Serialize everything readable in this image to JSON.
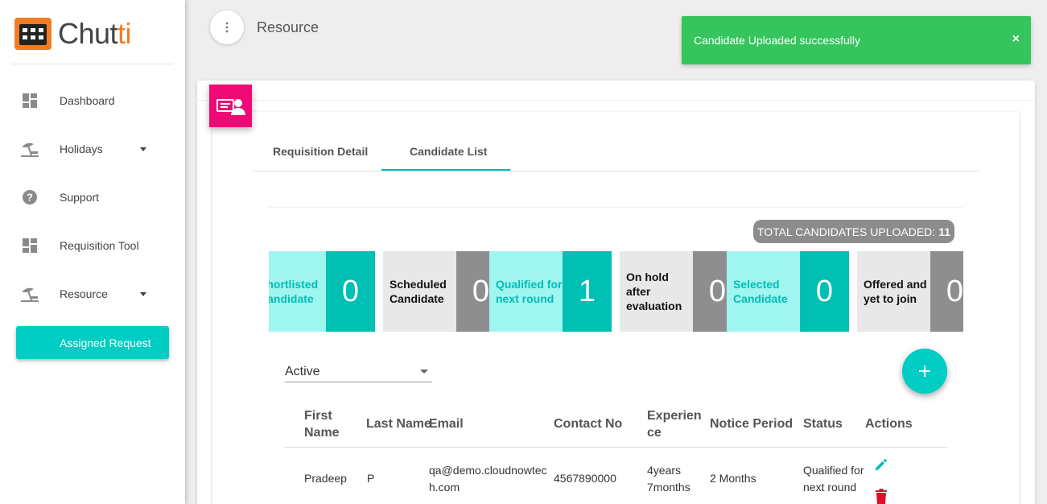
{
  "brand": {
    "name_main": "Chut",
    "name_accent": "ti"
  },
  "sidebar": {
    "items": [
      {
        "label": "Dashboard",
        "icon": "dashboard-icon"
      },
      {
        "label": "Holidays",
        "icon": "beach-icon"
      },
      {
        "label": "Support",
        "icon": "help-icon"
      },
      {
        "label": "Requisition Tool",
        "icon": "dashboard-icon"
      },
      {
        "label": "Resource",
        "icon": "beach-icon"
      }
    ],
    "button": "Assigned Request"
  },
  "header": {
    "title": "Resource"
  },
  "toast": {
    "message": "Candidate Uploaded successfully",
    "close": "×"
  },
  "tabs": [
    "Requisition Detail",
    "Candidate List"
  ],
  "active_tab": "Candidate List",
  "total": {
    "label": "TOTAL CANDIDATES UPLOADED:",
    "value": "11"
  },
  "stats": [
    {
      "label": "Shortlisted Candidate",
      "count": "0",
      "style": "teal"
    },
    {
      "label": "Scheduled Candidate",
      "count": "0",
      "style": "gray"
    },
    {
      "label": "Qualified for next round",
      "count": "1",
      "style": "teal"
    },
    {
      "label": "On hold after evaluation",
      "count": "0",
      "style": "gray"
    },
    {
      "label": "Selected Candidate",
      "count": "0",
      "style": "teal"
    },
    {
      "label": "Offered and yet to join",
      "count": "0",
      "style": "gray"
    }
  ],
  "filter": {
    "selected": "Active"
  },
  "table": {
    "headers": [
      "First Name",
      "Last Name",
      "Email",
      "Contact No",
      "Experience",
      "Notice Period",
      "Status",
      "Actions"
    ],
    "rows": [
      {
        "first": "Pradeep",
        "last": "P",
        "email": "qa@demo.cloudnowtech.com",
        "contact": "4567890000",
        "experience": "4years 7months",
        "notice": "2 Months",
        "status": "Qualified for next round"
      }
    ]
  },
  "colors": {
    "accent": "#00cdc3",
    "brand_orange": "#f47c20",
    "toast_green": "#36c45c",
    "header_icon_pink": "#ee0a74",
    "edit": "#00bfb3",
    "delete": "#e0102a"
  }
}
